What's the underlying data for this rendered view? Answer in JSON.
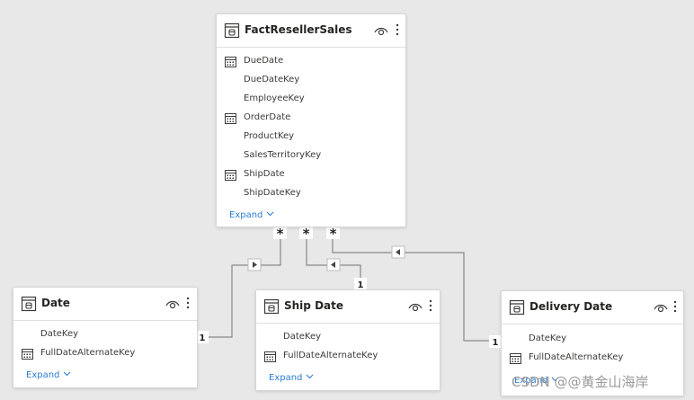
{
  "expand_label": "Expand",
  "tables": {
    "fact": {
      "title": "FactResellerSales",
      "fields": [
        "DueDate",
        "DueDateKey",
        "EmployeeKey",
        "OrderDate",
        "ProductKey",
        "SalesTerritoryKey",
        "ShipDate",
        "ShipDateKey"
      ],
      "date_fields": [
        "DueDate",
        "OrderDate",
        "ShipDate"
      ]
    },
    "date": {
      "title": "Date",
      "fields": [
        "DateKey",
        "FullDateAlternateKey"
      ]
    },
    "ship_date": {
      "title": "Ship Date",
      "fields": [
        "DateKey",
        "FullDateAlternateKey"
      ]
    },
    "delivery_date": {
      "title": "Delivery Date",
      "fields": [
        "DateKey",
        "FullDateAlternateKey"
      ]
    }
  },
  "relationships": {
    "many_label": "*",
    "one_label": "1"
  },
  "watermark": "CSDN @@黄金山海岸",
  "colors": {
    "background": "#e8e8e8",
    "line": "#8a8886",
    "link": "#2b7cd3"
  }
}
